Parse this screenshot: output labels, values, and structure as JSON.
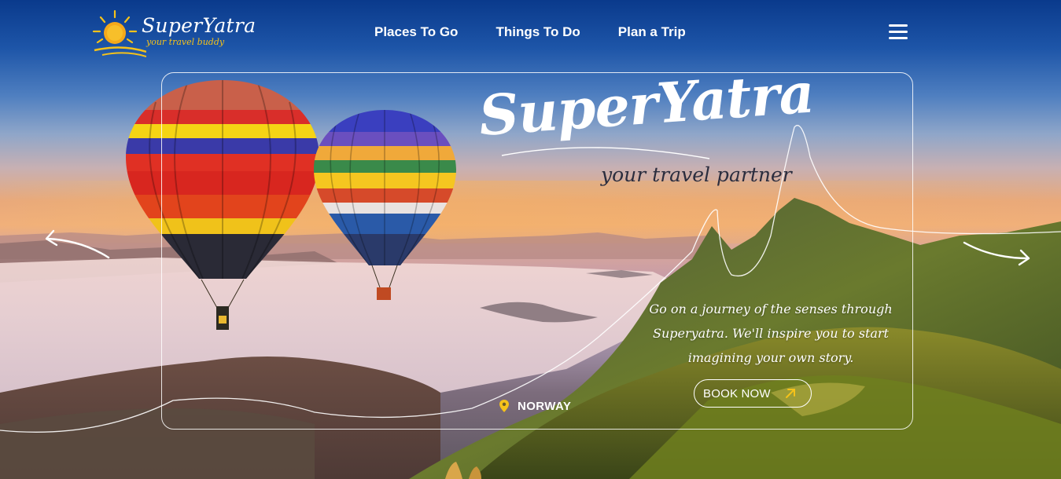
{
  "header": {
    "logo_title": "SuperYatra",
    "logo_tagline": "your travel buddy",
    "nav": [
      "Places To Go",
      "Things To Do",
      "Plan a Trip"
    ],
    "menu_icon": "hamburger-menu-icon"
  },
  "hero": {
    "title": "SuperYatra",
    "subtitle": "your travel partner",
    "description": "Go on a journey of the senses through Superyatra. We'll inspire you to start imagining your own story.",
    "book_button": "BOOK NOW",
    "book_icon": "arrow-up-right-icon",
    "location": "NORWAY",
    "location_icon": "map-pin-icon",
    "prev_icon": "curved-arrow-left-icon",
    "next_icon": "curved-arrow-right-icon"
  },
  "colors": {
    "accent": "#f5c21a",
    "sky_top": "#0a3a8c",
    "sunset": "#f1b07a",
    "text": "#ffffff",
    "subtitle": "#2b2d3e"
  }
}
